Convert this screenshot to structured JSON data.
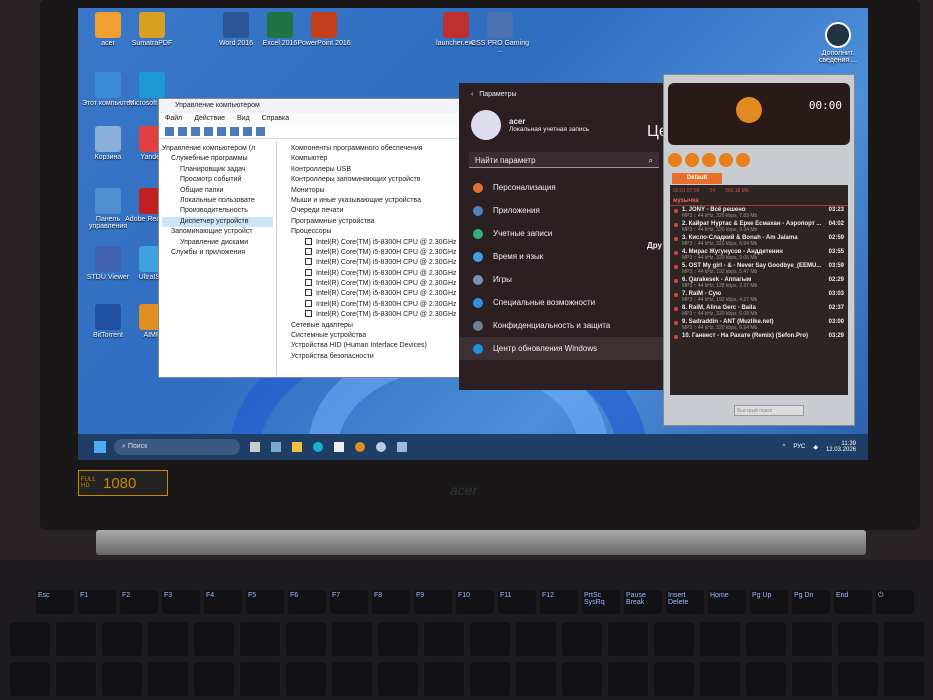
{
  "desktop": {
    "icons": [
      {
        "label": "acer",
        "color": "#f0a030"
      },
      {
        "label": "SumatraPDF",
        "color": "#d8a020"
      },
      {
        "label": "Word 2016",
        "color": "#2b579a"
      },
      {
        "label": "Excel 2016",
        "color": "#217346"
      },
      {
        "label": "PowerPoint 2016",
        "color": "#c43e1c"
      },
      {
        "label": "launcher.exe",
        "color": "#c03030"
      },
      {
        "label": "CSS PRO Gaming ...",
        "color": "#4a70b0"
      },
      {
        "label": "Этот компьютер",
        "color": "#3a8ad8"
      },
      {
        "label": "Microsoft Edge",
        "color": "#1a9ad0"
      },
      {
        "label": "Корзина",
        "color": "#8ab0d8"
      },
      {
        "label": "Yandex",
        "color": "#e04040"
      },
      {
        "label": "Панель управления",
        "color": "#5090d0"
      },
      {
        "label": "Adobe Reader XI",
        "color": "#c02020"
      },
      {
        "label": "STDU Viewer",
        "color": "#4060b0"
      },
      {
        "label": "UltraISO",
        "color": "#40a0e0"
      },
      {
        "label": "BitTorrent",
        "color": "#2050a0"
      },
      {
        "label": "AIMP",
        "color": "#e09020"
      }
    ],
    "corner_label": "Дополнит. сведения ..."
  },
  "computer_management": {
    "title": "Управление компьютером",
    "menu": [
      "Файл",
      "Действие",
      "Вид",
      "Справка"
    ],
    "tree": [
      "Управление компьютером (л",
      "Служебные программы",
      "Планировщик задач",
      "Просмотр событий",
      "Общие папки",
      "Локальные пользовате",
      "Производительность",
      "Диспетчер устройств",
      "Запоминающие устройст",
      "Управление дисками",
      "Службы и приложения"
    ],
    "devices": [
      "Компоненты программного обеспечения",
      "Компьютер",
      "Контроллеры USB",
      "Контроллеры запоминающих устройств",
      "Мониторы",
      "Мыши и иные указывающие устройства",
      "Очереди печати",
      "Программные устройства",
      "Процессоры"
    ],
    "cpu": "Intel(R) Core(TM) i5-8300H CPU @ 2.30GHz",
    "devices_after": [
      "Сетевые адаптеры",
      "Системные устройства",
      "Устройства HID (Human Interface Devices)",
      "Устройства безопасности"
    ]
  },
  "settings": {
    "title": "Параметры",
    "user": "acer",
    "account": "Локальная учетная запись",
    "search_placeholder": "Найти параметр",
    "heading_partial": "Це",
    "sub_partial": "Дру",
    "items": [
      {
        "label": "Персонализация",
        "color": "#e07030"
      },
      {
        "label": "Приложения",
        "color": "#5080c0"
      },
      {
        "label": "Учетные записи",
        "color": "#30b080"
      },
      {
        "label": "Время и язык",
        "color": "#40a0e0"
      },
      {
        "label": "Игры",
        "color": "#8090b0"
      },
      {
        "label": "Специальные возможности",
        "color": "#3090e0"
      },
      {
        "label": "Конфиденциальность и защита",
        "color": "#708090"
      },
      {
        "label": "Центр обновления Windows",
        "color": "#2090e0"
      }
    ]
  },
  "aimp": {
    "time": "00:00",
    "playlist_tab": "Default",
    "info": [
      "00:01:07:59",
      "34",
      "396.18 Mb"
    ],
    "group": "музычка",
    "search_placeholder": "Быстрый поиск",
    "tracks": [
      {
        "title": "1. JONY - Всё решено",
        "dur": "03:23",
        "meta": "MP3 :: 44 kHz, 320 kbps, 7.83 Mb"
      },
      {
        "title": "2. Кайрат Нуртас & Ерке Есмахан - Аэропорт ...",
        "dur": "04:02",
        "meta": "MP3 :: 44 kHz, 320 kbps, 9.34 Mb"
      },
      {
        "title": "3. Кисло-Сладкий & Bonah - Am Jalama",
        "dur": "02:59",
        "meta": "MP3 :: 44 kHz, 320 kbps, 6.94 Mb"
      },
      {
        "title": "4. Мирас Жугунусов - Анддетенин",
        "dur": "03:55",
        "meta": "MP3 :: 44 kHz, 320 kbps, 9.05 Mb"
      },
      {
        "title": "5. OST My girl - & - Never Say Goodbye_(EEMU...",
        "dur": "03:59",
        "meta": "MP3 :: 44 kHz, 192 kbps, 5.47 Mb"
      },
      {
        "title": "6. Qarakesek - Аппагым",
        "dur": "02:29",
        "meta": "MP3 :: 44 kHz, 128 kbps, 2.37 Mb"
      },
      {
        "title": "7. RaiM - Сую",
        "dur": "03:03",
        "meta": "MP3 :: 44 kHz, 192 kbps, 4.27 Mb"
      },
      {
        "title": "8. RaiM, Alina Gerc - Baila",
        "dur": "02:37",
        "meta": "MP3 :: 44 kHz, 320 kbps, 6.08 Mb"
      },
      {
        "title": "9. Sadraddin - ANT (Muzlike.net)",
        "dur": "03:00",
        "meta": "MP3 :: 44 kHz, 320 kbps, 6.94 Mb"
      },
      {
        "title": "10. Ганвест - На Рахате (Remix) (Sefon.Pro)",
        "dur": "03:29",
        "meta": ""
      }
    ]
  },
  "taskbar": {
    "search": "Поиск",
    "lang": "РУС",
    "time": "11:39",
    "date": "12.03.2026"
  },
  "laptop": {
    "badge_top": "FULL HD",
    "badge_num": "1080",
    "brand": "acer"
  },
  "keyboard": [
    "Esc",
    "F1",
    "F2",
    "F3",
    "F4",
    "F5",
    "F6",
    "F7",
    "F8",
    "F9",
    "F10",
    "F11",
    "F12",
    "PrtSc SysRq",
    "Pause Break",
    "Insert Delete",
    "Home",
    "Pg Up",
    "Pg Dn",
    "End",
    "⏻"
  ]
}
